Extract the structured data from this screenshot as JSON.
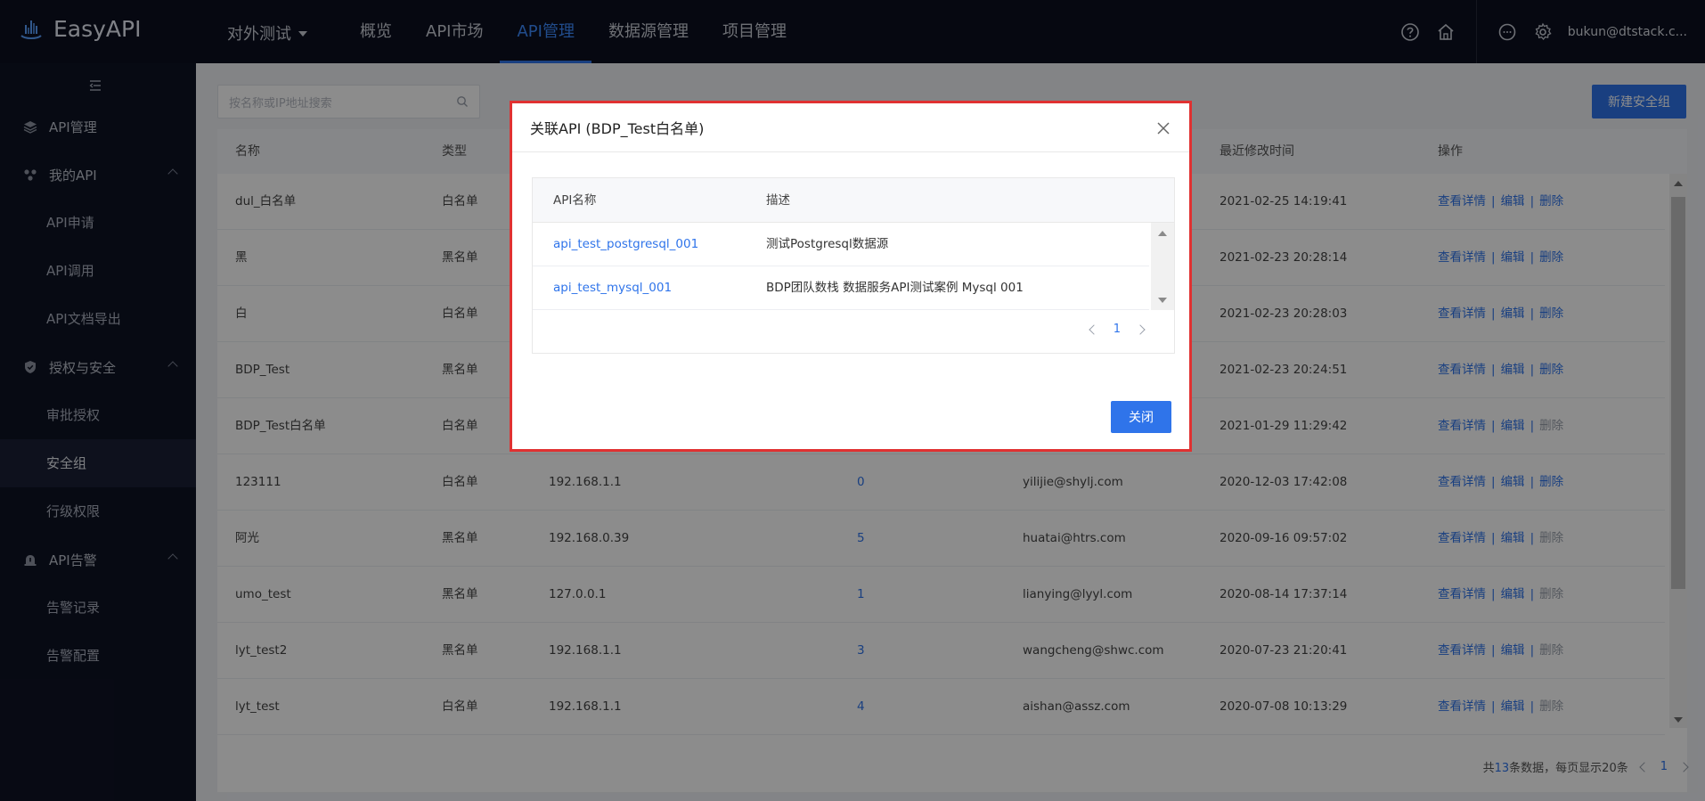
{
  "app": {
    "name": "EasyAPI"
  },
  "header": {
    "project": "对外测试",
    "nav": [
      "概览",
      "API市场",
      "API管理",
      "数据源管理",
      "项目管理"
    ],
    "active_nav": "API管理",
    "user": "bukun@dtstack.c..."
  },
  "sidebar": {
    "groups": [
      {
        "label": "API管理",
        "icon": "layers-icon",
        "children": []
      },
      {
        "label": "我的API",
        "icon": "cluster-icon",
        "children": [
          "API申请",
          "API调用",
          "API文档导出"
        ]
      },
      {
        "label": "授权与安全",
        "icon": "shield-icon",
        "children": [
          "审批授权",
          "安全组",
          "行级权限"
        ]
      },
      {
        "label": "API告警",
        "icon": "alarm-icon",
        "children": [
          "告警记录",
          "告警配置"
        ]
      }
    ],
    "active_item": "安全组"
  },
  "toolbar": {
    "search_placeholder": "按名称或IP地址搜索",
    "new_button": "新建安全组"
  },
  "table": {
    "headers": [
      "名称",
      "类型",
      "",
      "",
      "",
      "最近修改时间",
      "操作"
    ],
    "rows": [
      {
        "name": "dul_白名单",
        "type": "白名单",
        "ip": "",
        "count": "",
        "owner": "",
        "time": "2021-02-25 14:19:41",
        "delete_enabled": true
      },
      {
        "name": "黑",
        "type": "黑名单",
        "ip": "",
        "count": "",
        "owner": "",
        "time": "2021-02-23 20:28:14",
        "delete_enabled": true
      },
      {
        "name": "白",
        "type": "白名单",
        "ip": "",
        "count": "",
        "owner": "",
        "time": "2021-02-23 20:28:03",
        "delete_enabled": true
      },
      {
        "name": "BDP_Test",
        "type": "黑名单",
        "ip": "",
        "count": "",
        "owner": "",
        "time": "2021-02-23 20:24:51",
        "delete_enabled": true
      },
      {
        "name": "BDP_Test白名单",
        "type": "白名单",
        "ip": "",
        "count": "",
        "owner": "",
        "time": "2021-01-29 11:29:42",
        "delete_enabled": false
      },
      {
        "name": "123111",
        "type": "白名单",
        "ip": "192.168.1.1",
        "count": "0",
        "owner": "yilijie@shylj.com",
        "time": "2020-12-03 17:42:08",
        "delete_enabled": true
      },
      {
        "name": "阿光",
        "type": "黑名单",
        "ip": "192.168.0.39",
        "count": "5",
        "owner": "huatai@htrs.com",
        "time": "2020-09-16 09:57:02",
        "delete_enabled": false
      },
      {
        "name": "umo_test",
        "type": "黑名单",
        "ip": "127.0.0.1",
        "count": "1",
        "owner": "lianying@lyyl.com",
        "time": "2020-08-14 17:37:14",
        "delete_enabled": false
      },
      {
        "name": "lyt_test2",
        "type": "黑名单",
        "ip": "192.168.1.1",
        "count": "3",
        "owner": "wangcheng@shwc.com",
        "time": "2020-07-23 21:20:41",
        "delete_enabled": false
      },
      {
        "name": "lyt_test",
        "type": "白名单",
        "ip": "192.168.1.1",
        "count": "4",
        "owner": "aishan@assz.com",
        "time": "2020-07-08 10:13:29",
        "delete_enabled": false
      }
    ],
    "ops": {
      "detail": "查看详情",
      "edit": "编辑",
      "delete": "删除",
      "sep": "|"
    }
  },
  "pagination": {
    "prefix": "共",
    "total": "13",
    "suffix": "条数据，每页显示20条",
    "page": "1"
  },
  "modal": {
    "title": "关联API (BDP_Test白名单)",
    "headers": [
      "API名称",
      "描述"
    ],
    "rows": [
      {
        "name": "api_test_postgresql_001",
        "desc": "测试Postgresql数据源"
      },
      {
        "name": "api_test_mysql_001",
        "desc": "BDP团队数栈 数据服务API测试案例 Mysql 001"
      }
    ],
    "page": "1",
    "close_button": "关闭"
  },
  "colors": {
    "accent": "#2f74ea",
    "topbar": "#0b1020",
    "sidebar": "#0e1324",
    "highlight_border": "#e03131"
  }
}
